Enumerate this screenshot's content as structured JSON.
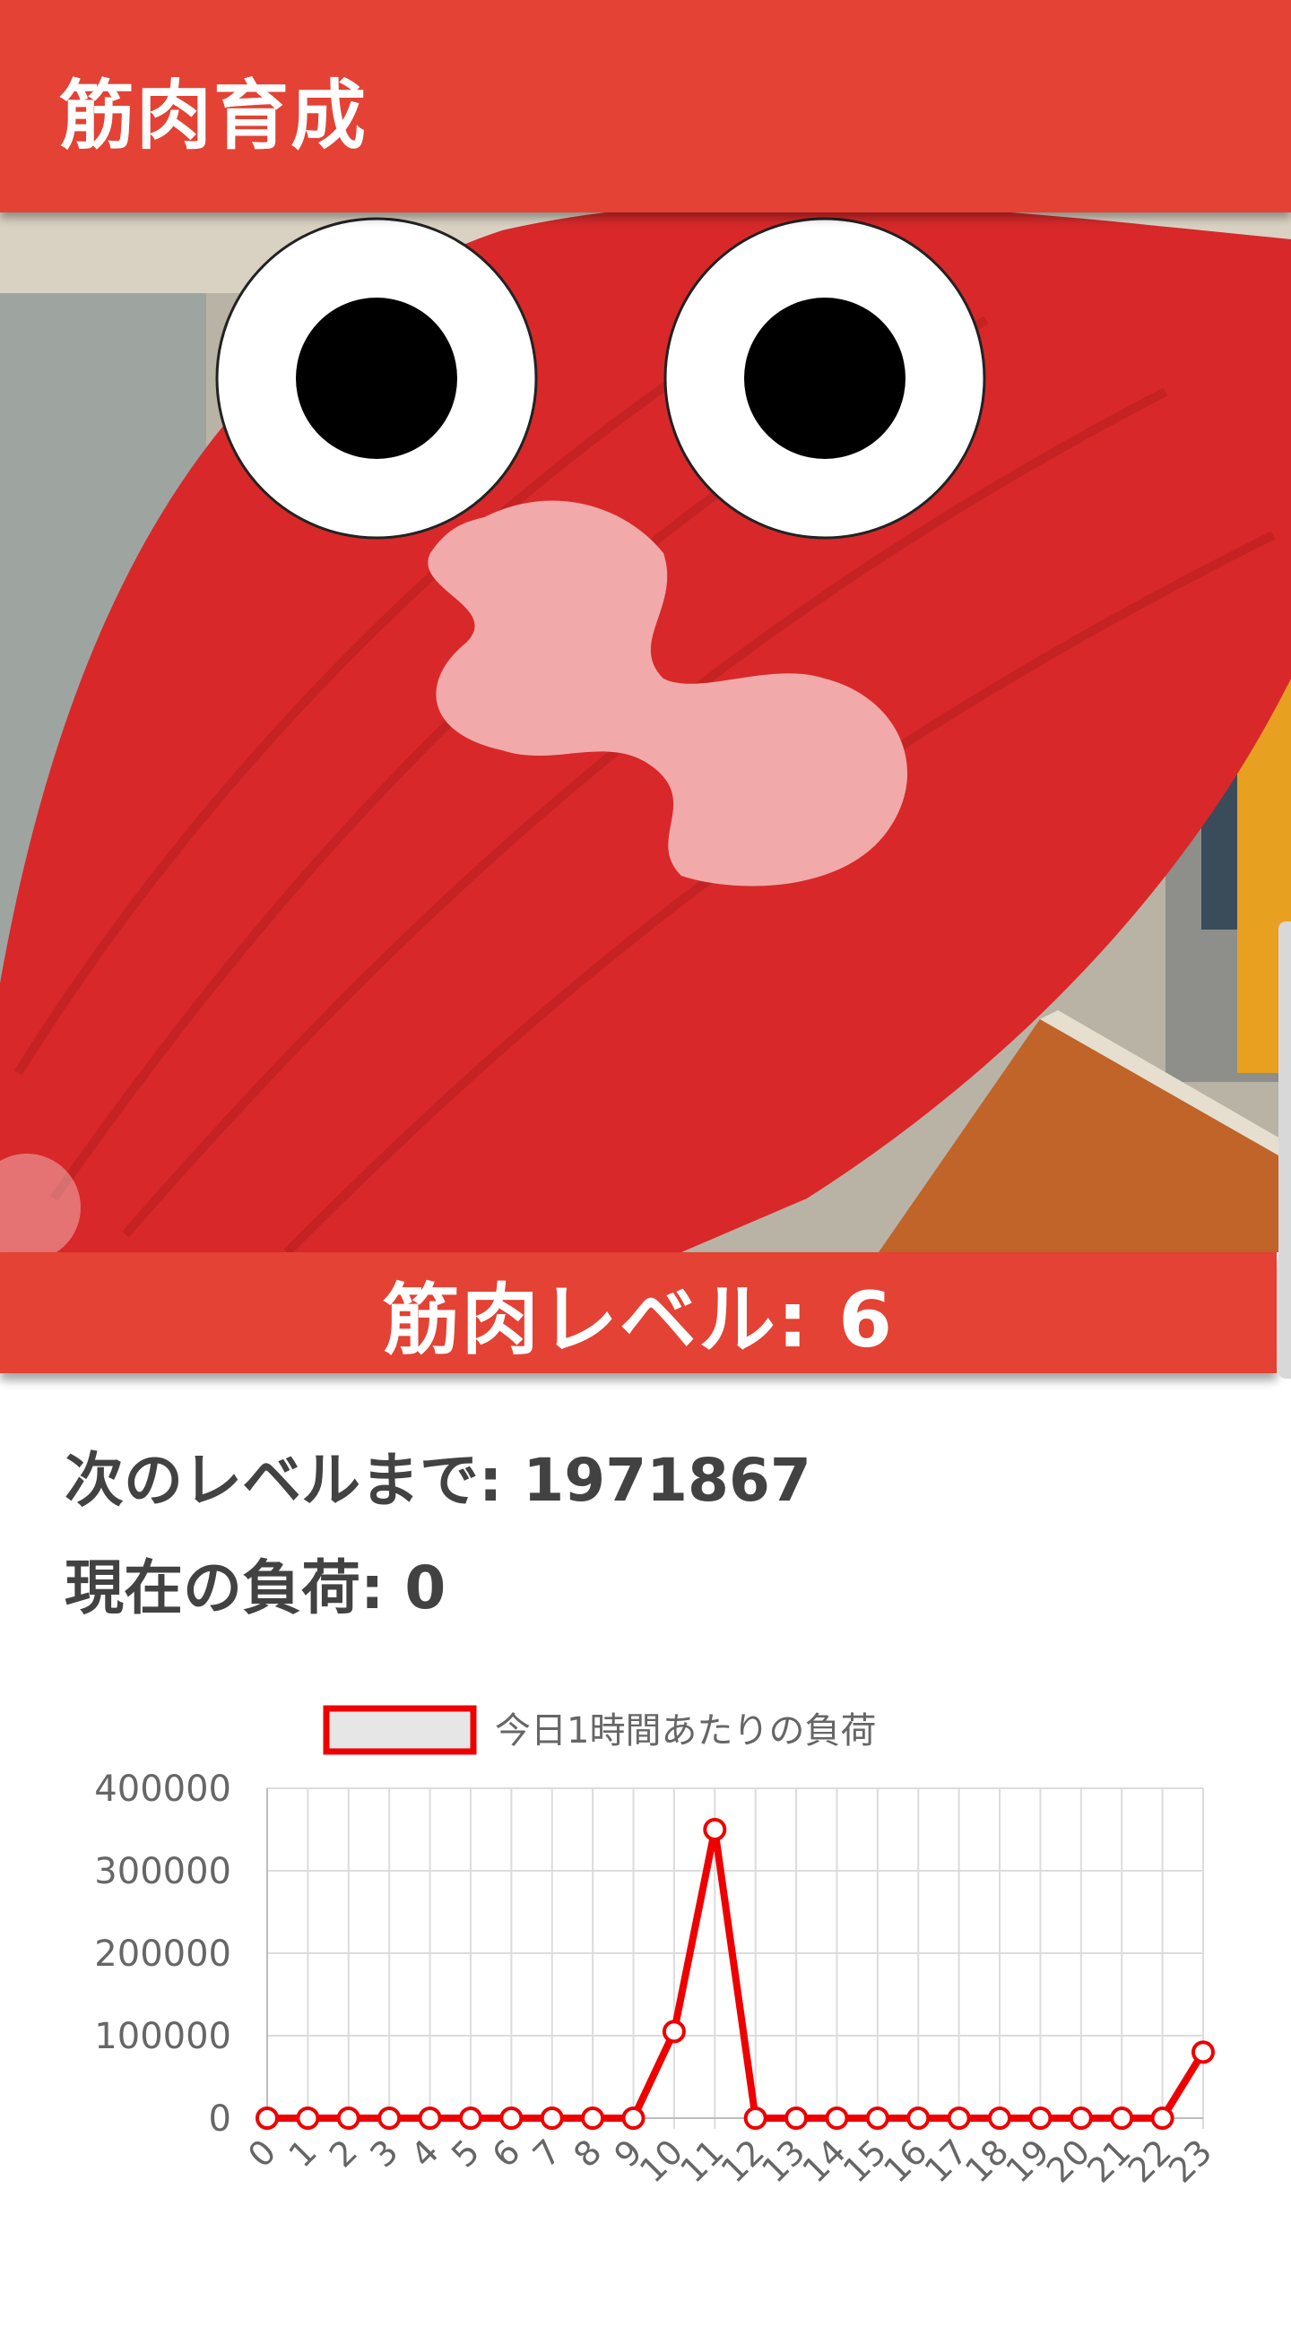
{
  "app": {
    "title": "筋肉育成"
  },
  "level_banner": {
    "text": "筋肉レベル: 6"
  },
  "stats": {
    "next_level": "次のレベルまで: 1971867",
    "current_load": "現在の負荷: 0"
  },
  "colors": {
    "accent": "#e34234",
    "line": "#ee0000",
    "legend_fill": "#e6e6e6"
  },
  "chart_data": {
    "type": "line",
    "legend": "今日1時間あたりの負荷",
    "x": [
      "0",
      "1",
      "2",
      "3",
      "4",
      "5",
      "6",
      "7",
      "8",
      "9",
      "10",
      "11",
      "12",
      "13",
      "14",
      "15",
      "16",
      "17",
      "18",
      "19",
      "20",
      "21",
      "22",
      "23"
    ],
    "series": [
      {
        "name": "今日1時間あたりの負荷",
        "values": [
          0,
          0,
          0,
          0,
          0,
          0,
          0,
          0,
          0,
          0,
          105000,
          350000,
          0,
          0,
          0,
          0,
          0,
          0,
          0,
          0,
          0,
          0,
          0,
          80000
        ]
      }
    ],
    "ylim": [
      0,
      400000
    ],
    "yticks": [
      "400000",
      "300000",
      "200000",
      "100000",
      "0"
    ],
    "grid": true,
    "legend_position": "top"
  }
}
